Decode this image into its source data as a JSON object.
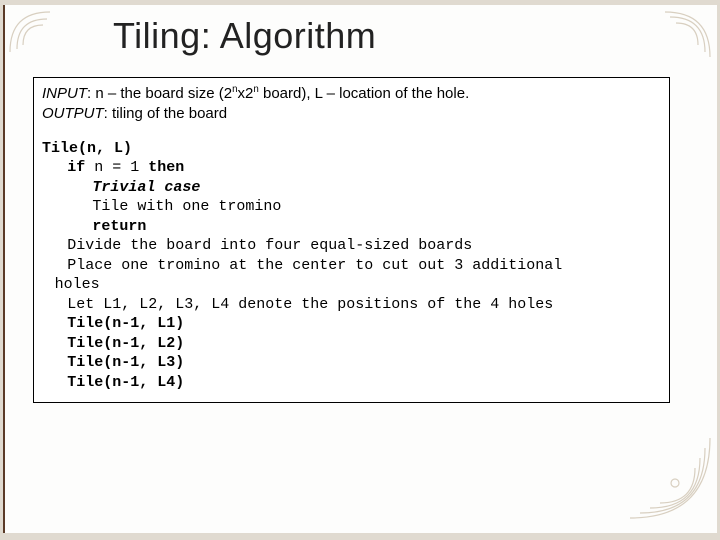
{
  "title": "Tiling: Algorithm",
  "spec": {
    "input_label": "INPUT",
    "input_text1": ": n  – the board size (2",
    "input_sup1": "n",
    "input_text2": "x2",
    "input_sup2": "n",
    "input_text3": " board), L – location of the hole.",
    "output_label": "OUTPUT",
    "output_text": ": tiling of the board"
  },
  "code": {
    "l1": "Tile(n, L)",
    "l2a": "if",
    "l2b": " n = 1 ",
    "l2c": "then",
    "l3": "Trivial case",
    "l4": "Tile with one tromino",
    "l5": "return",
    "l6": "Divide the board into four equal-sized boards",
    "l7": "Place one tromino at the center to cut out 3 additional",
    "l7b": "holes",
    "l8": "Let L1, L2, L3, L4 denote the positions of the 4 holes",
    "l9": "Tile(n-1, L1)",
    "l10": "Tile(n-1, L2)",
    "l11": "Tile(n-1, L3)",
    "l12": "Tile(n-1, L4)"
  }
}
